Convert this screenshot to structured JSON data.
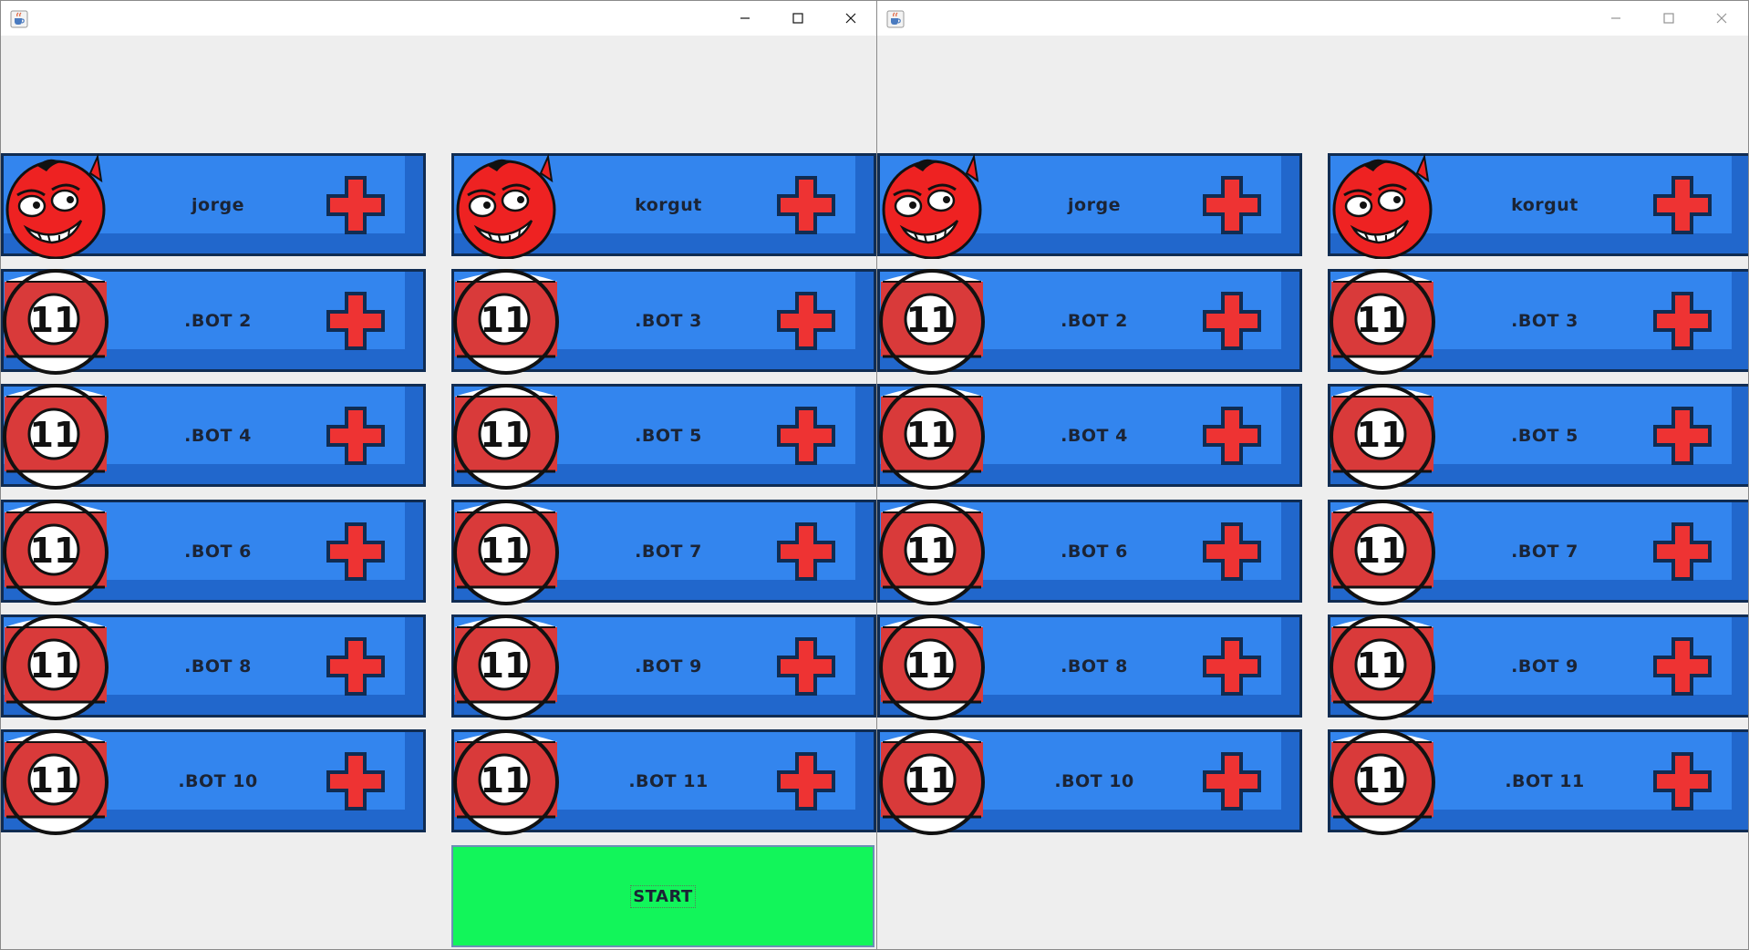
{
  "windows": [
    {
      "players": [
        {
          "name": "jorge",
          "avatar": "devil"
        },
        {
          "name": "korgut",
          "avatar": "devil"
        },
        {
          "name": ".BOT 2",
          "avatar": "ball-11"
        },
        {
          "name": ".BOT 3",
          "avatar": "ball-11"
        },
        {
          "name": ".BOT 4",
          "avatar": "ball-11"
        },
        {
          "name": ".BOT 5",
          "avatar": "ball-11"
        },
        {
          "name": ".BOT 6",
          "avatar": "ball-11"
        },
        {
          "name": ".BOT 7",
          "avatar": "ball-11"
        },
        {
          "name": ".BOT 8",
          "avatar": "ball-11"
        },
        {
          "name": ".BOT 9",
          "avatar": "ball-11"
        },
        {
          "name": ".BOT 10",
          "avatar": "ball-11"
        },
        {
          "name": ".BOT 11",
          "avatar": "ball-11"
        }
      ],
      "start_label": "START",
      "active": true
    },
    {
      "players": [
        {
          "name": "jorge",
          "avatar": "devil"
        },
        {
          "name": "korgut",
          "avatar": "devil"
        },
        {
          "name": ".BOT 2",
          "avatar": "ball-11"
        },
        {
          "name": ".BOT 3",
          "avatar": "ball-11"
        },
        {
          "name": ".BOT 4",
          "avatar": "ball-11"
        },
        {
          "name": ".BOT 5",
          "avatar": "ball-11"
        },
        {
          "name": ".BOT 6",
          "avatar": "ball-11"
        },
        {
          "name": ".BOT 7",
          "avatar": "ball-11"
        },
        {
          "name": ".BOT 8",
          "avatar": "ball-11"
        },
        {
          "name": ".BOT 9",
          "avatar": "ball-11"
        },
        {
          "name": ".BOT 10",
          "avatar": "ball-11"
        },
        {
          "name": ".BOT 11",
          "avatar": "ball-11"
        }
      ],
      "active": false
    }
  ],
  "ball_number": "11",
  "colors": {
    "card": "#3385ee",
    "card_shade": "#2167cc",
    "card_border": "#102c52",
    "plus": "#ee3333",
    "start": "#12f55a",
    "ball_red": "#d93a3a",
    "devil_red": "#ee2222"
  },
  "icons": {
    "app": "java-cup-icon",
    "add": "plus-icon",
    "minimize": "minimize-icon",
    "maximize": "maximize-icon",
    "close": "close-icon"
  }
}
